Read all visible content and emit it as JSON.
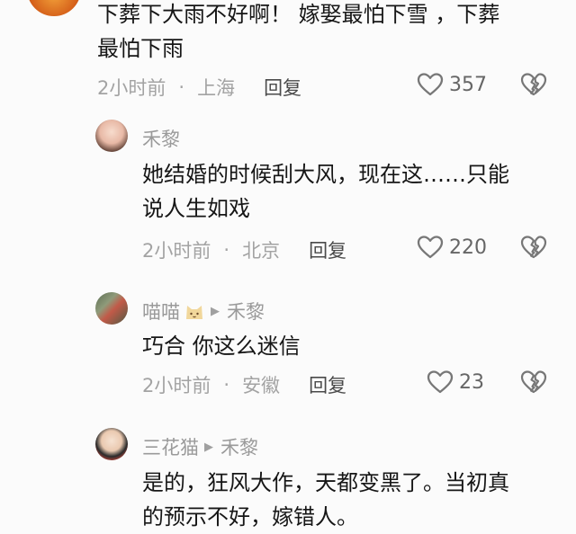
{
  "comments": [
    {
      "text_lines": [
        "下葬下大雨不好啊！ 嫁娶最怕下雪 ，下葬",
        "最怕下雨"
      ],
      "time": "2小时前",
      "location": "上海",
      "reply_label": "回复",
      "likes": "357"
    },
    {
      "username": "禾黎",
      "text_lines": [
        "她结婚的时候刮大风，现在这……只能",
        "说人生如戏"
      ],
      "time": "2小时前",
      "location": "北京",
      "reply_label": "回复",
      "likes": "220"
    },
    {
      "username": "喵喵",
      "reply_to": "禾黎",
      "text_lines": [
        "巧合 你这么迷信"
      ],
      "time": "2小时前",
      "location": "安徽",
      "reply_label": "回复",
      "likes": "23"
    },
    {
      "username": "三花猫",
      "reply_to": "禾黎",
      "text_lines": [
        "是的，狂风大作，天都变黑了。当初真",
        "的预示不好，嫁错人。"
      ]
    }
  ],
  "separator": "·",
  "icons": {
    "like": "heart-outline-icon",
    "dislike": "broken-heart-icon",
    "reply_arrow": "triangle-right-icon",
    "cat": "cat-emoji-icon"
  },
  "colors": {
    "meta": "#a3a3a3",
    "text": "#161616",
    "username": "#9a9a9a",
    "background": "#fbfbfb"
  }
}
